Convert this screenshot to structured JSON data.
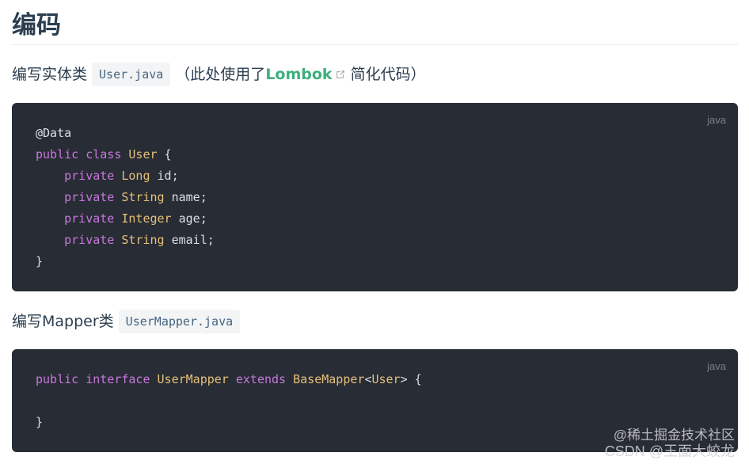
{
  "heading": "编码",
  "section1": {
    "text_before": "编写实体类",
    "code": "User.java",
    "text_mid": "（此处使用了",
    "link": "Lombok",
    "text_after": "简化代码）"
  },
  "code_block_1": {
    "lang": "java",
    "lines": [
      {
        "t": [
          [
            "pl",
            "@Data"
          ]
        ]
      },
      {
        "t": [
          [
            "kw",
            "public"
          ],
          [
            "pl",
            " "
          ],
          [
            "kw",
            "class"
          ],
          [
            "pl",
            " "
          ],
          [
            "ty",
            "User"
          ],
          [
            "pl",
            " {"
          ]
        ]
      },
      {
        "t": [
          [
            "pl",
            "    "
          ],
          [
            "kw",
            "private"
          ],
          [
            "pl",
            " "
          ],
          [
            "ty",
            "Long"
          ],
          [
            "pl",
            " id;"
          ]
        ]
      },
      {
        "t": [
          [
            "pl",
            "    "
          ],
          [
            "kw",
            "private"
          ],
          [
            "pl",
            " "
          ],
          [
            "ty",
            "String"
          ],
          [
            "pl",
            " name;"
          ]
        ]
      },
      {
        "t": [
          [
            "pl",
            "    "
          ],
          [
            "kw",
            "private"
          ],
          [
            "pl",
            " "
          ],
          [
            "ty",
            "Integer"
          ],
          [
            "pl",
            " age;"
          ]
        ]
      },
      {
        "t": [
          [
            "pl",
            "    "
          ],
          [
            "kw",
            "private"
          ],
          [
            "pl",
            " "
          ],
          [
            "ty",
            "String"
          ],
          [
            "pl",
            " email;"
          ]
        ]
      },
      {
        "t": [
          [
            "pl",
            "}"
          ]
        ]
      }
    ]
  },
  "section2": {
    "text_before": "编写Mapper类",
    "code": "UserMapper.java"
  },
  "code_block_2": {
    "lang": "java",
    "lines": [
      {
        "t": [
          [
            "kw",
            "public"
          ],
          [
            "pl",
            " "
          ],
          [
            "kw",
            "interface"
          ],
          [
            "pl",
            " "
          ],
          [
            "ty",
            "UserMapper"
          ],
          [
            "pl",
            " "
          ],
          [
            "kw",
            "extends"
          ],
          [
            "pl",
            " "
          ],
          [
            "ty",
            "BaseMapper"
          ],
          [
            "pl",
            "<"
          ],
          [
            "ty",
            "User"
          ],
          [
            "pl",
            "> {"
          ]
        ]
      },
      {
        "t": [
          [
            "pl",
            " "
          ]
        ]
      },
      {
        "t": [
          [
            "pl",
            "}"
          ]
        ]
      }
    ]
  },
  "watermark": {
    "line1": "@稀土掘金技术社区",
    "line2": "CSDN @王面大蛟龙"
  }
}
